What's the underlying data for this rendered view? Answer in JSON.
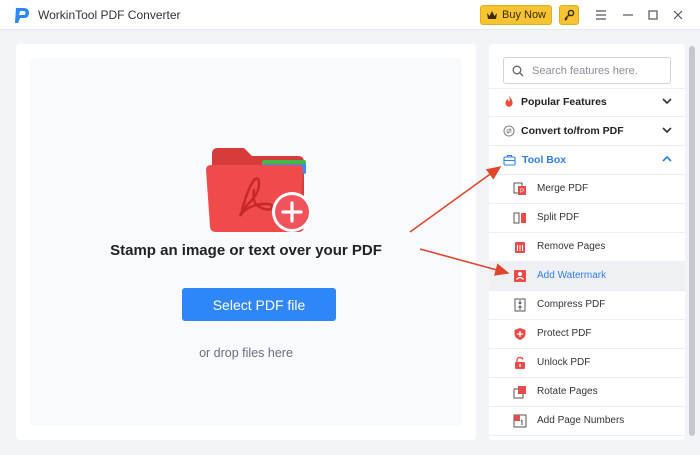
{
  "app": {
    "title": "WorkinTool PDF Converter"
  },
  "titlebar": {
    "buy_label": "Buy Now",
    "icons": [
      "app-logo-icon",
      "crown-icon",
      "key-icon",
      "menu-icon",
      "minimize-icon",
      "maximize-icon",
      "close-icon"
    ]
  },
  "main": {
    "heading": "Stamp an image or text over your PDF",
    "select_button": "Select PDF file",
    "drop_hint": "or drop files here"
  },
  "sidebar": {
    "search": {
      "placeholder": "Search features here.",
      "value": ""
    },
    "sections": [
      {
        "label": "Popular Features",
        "icon": "flame-icon",
        "expanded": false
      },
      {
        "label": "Convert to/from PDF",
        "icon": "convert-icon",
        "expanded": false
      },
      {
        "label": "Tool Box",
        "icon": "toolbox-icon",
        "expanded": true
      }
    ],
    "tools": [
      {
        "label": "Merge PDF",
        "icon": "merge-icon"
      },
      {
        "label": "Split PDF",
        "icon": "split-icon"
      },
      {
        "label": "Remove Pages",
        "icon": "trash-icon"
      },
      {
        "label": "Add Watermark",
        "icon": "watermark-icon",
        "selected": true
      },
      {
        "label": "Compress PDF",
        "icon": "compress-icon"
      },
      {
        "label": "Protect PDF",
        "icon": "shield-icon"
      },
      {
        "label": "Unlock PDF",
        "icon": "unlock-icon"
      },
      {
        "label": "Rotate Pages",
        "icon": "rotate-icon"
      },
      {
        "label": "Add Page Numbers",
        "icon": "page-number-icon"
      }
    ]
  },
  "colors": {
    "accent": "#2f86f6",
    "active_text": "#2f7ef0",
    "buy_button": "#f6c433",
    "icon_red": "#e94b4b",
    "arrow_red": "#e0452e"
  }
}
